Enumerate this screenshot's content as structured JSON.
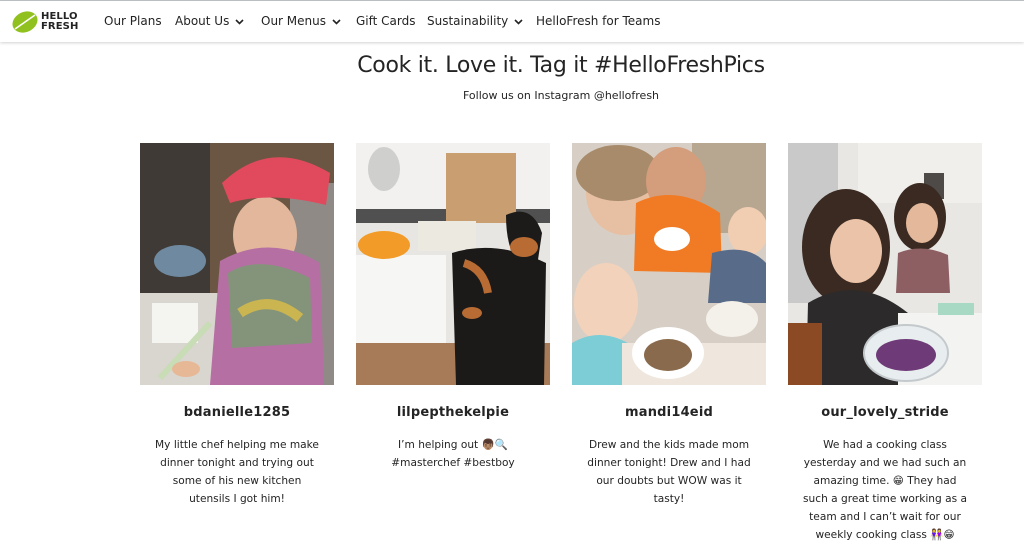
{
  "brand": {
    "logo_text_line1": "HELLO",
    "logo_text_line2": "FRESH",
    "accent": "#91C11E"
  },
  "nav": {
    "items": [
      {
        "label": "Our Plans",
        "dropdown": false
      },
      {
        "label": "About Us",
        "dropdown": true
      },
      {
        "label": "Our Menus",
        "dropdown": true
      },
      {
        "label": "Gift Cards",
        "dropdown": false
      },
      {
        "label": "Sustainability",
        "dropdown": true
      },
      {
        "label": "HelloFresh for Teams",
        "dropdown": false
      }
    ]
  },
  "section": {
    "title": "Cook it. Love it. Tag it #HelloFreshPics",
    "subtitle": "Follow us on Instagram @hellofresh"
  },
  "posts": [
    {
      "handle": "bdanielle1285",
      "caption": "My little chef helping me make dinner tonight and trying out some of his new kitchen utensils I got him!"
    },
    {
      "handle": "lilpepthekelpie",
      "caption": "I’m helping out 👦🏽🔍 #masterchef #bestboy"
    },
    {
      "handle": "mandi14eid",
      "caption": "Drew and the kids made mom dinner tonight! Drew and I had our doubts but WOW was it tasty!"
    },
    {
      "handle": "our_lovely_stride",
      "caption": "We had a cooking class yesterday and we had such an amazing time. 😁 They had such a great time working as a team and I can’t wait for our weekly cooking class 👭😁"
    }
  ]
}
